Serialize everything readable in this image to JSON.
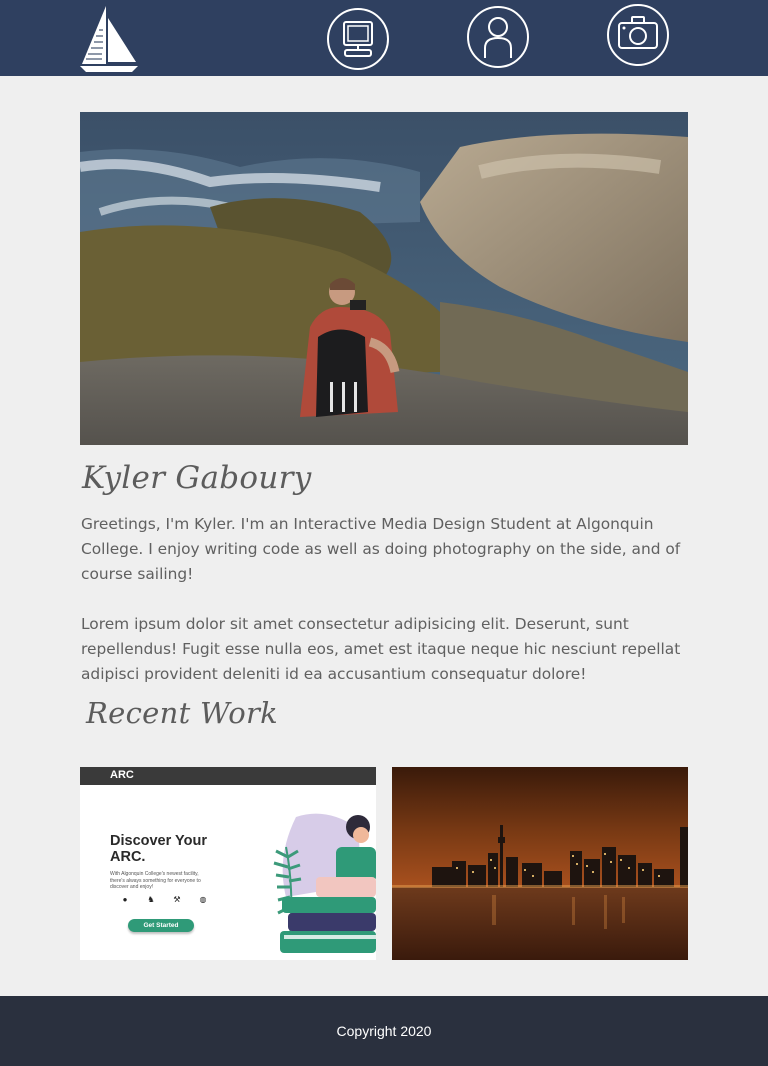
{
  "header": {
    "nav": [
      {
        "icon": "computer-icon"
      },
      {
        "icon": "user-icon"
      },
      {
        "icon": "camera-icon"
      }
    ],
    "logo_icon": "sailboat-icon"
  },
  "hero": {
    "image": "photo of person photographing rocky coastline"
  },
  "profile": {
    "name": "Kyler Gaboury",
    "intro": "Greetings, I'm Kyler. I'm an Interactive Media Design Student at Algonquin College. I enjoy writing code as well as doing photography on the side, and of course sailing!",
    "lorem": "Lorem ipsum dolor sit amet consectetur adipisicing elit. Deserunt, sunt repellendus! Fugit esse nulla eos, amet est itaque neque hic nesciunt repellat adipisci provident deleniti id ea accusantium consequatur dolore!"
  },
  "recent_work": {
    "heading": "Recent Work",
    "arc": {
      "brand": "ARC",
      "title": "Discover Your ARC.",
      "desc": "With Algonquin College's newest facility, there's always something for everyone to discover and enjoy!",
      "button": "Get Started"
    }
  },
  "footer": {
    "copyright": "Copyright 2020"
  },
  "colors": {
    "header_bg": "#2f4060",
    "page_bg": "#efefef",
    "footer_bg": "#2a303e",
    "text": "#606060",
    "accent_green": "#2f9a78"
  }
}
